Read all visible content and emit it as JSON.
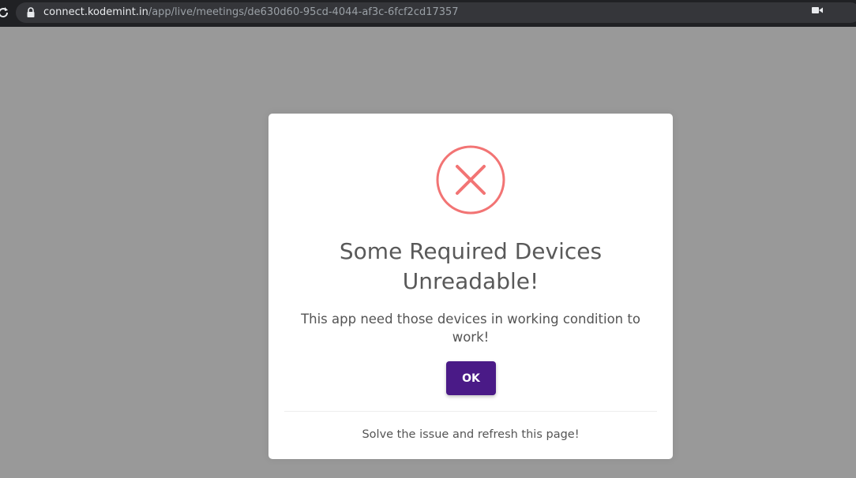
{
  "browser": {
    "url_domain": "connect.kodemint.in",
    "url_path": "/app/live/meetings/de630d60-95cd-4044-af3c-6fcf2cd17357",
    "icons": {
      "reload": "reload-icon",
      "lock": "lock-icon",
      "camera": "camera-icon"
    }
  },
  "dialog": {
    "icon": "error-x-circle-icon",
    "icon_color": "#f27474",
    "title": "Some Required Devices Unreadable!",
    "message": "This app need those devices in working condition to work!",
    "ok_label": "OK",
    "ok_color": "#4a1a87",
    "footer": "Solve the issue and refresh this page!"
  },
  "colors": {
    "overlay": "#999999",
    "browser_bar": "#202124",
    "omnibox": "#35363a"
  }
}
